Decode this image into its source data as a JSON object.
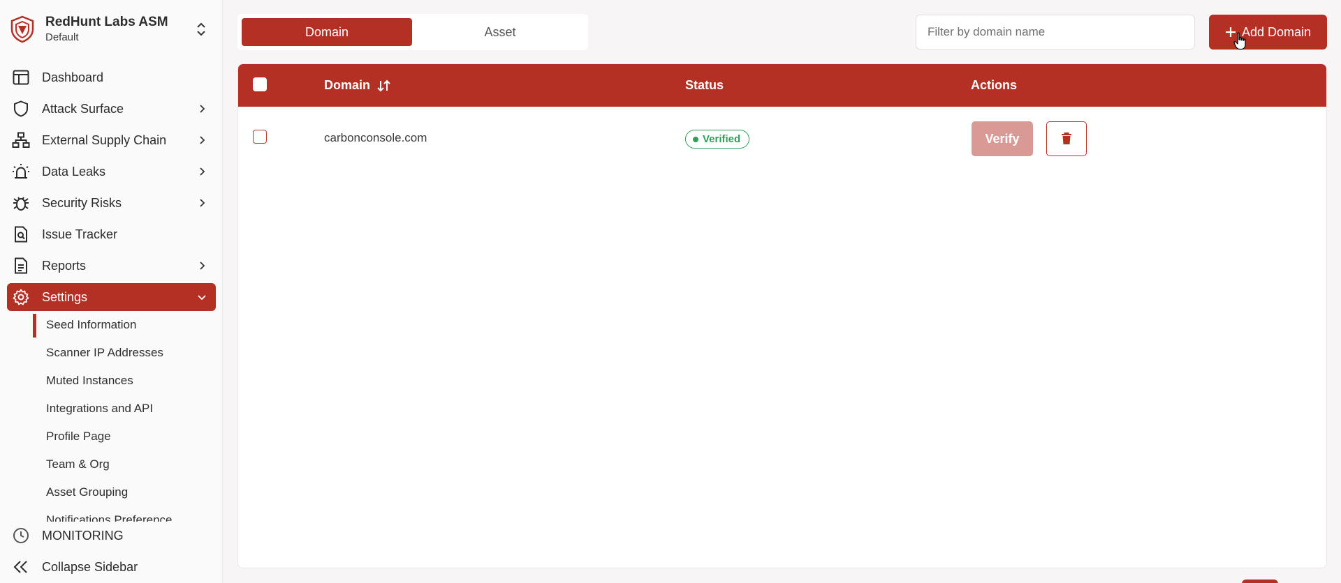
{
  "brand": {
    "name": "RedHunt Labs ASM",
    "workspace": "Default",
    "logo_icon": "shield-logo-icon",
    "switch_icon": "chevron-up-down-icon"
  },
  "sidebar": {
    "items": [
      {
        "label": "Dashboard",
        "icon": "layout-icon"
      },
      {
        "label": "Attack Surface",
        "icon": "shield-icon"
      },
      {
        "label": "External Supply Chain",
        "icon": "network-icon"
      },
      {
        "label": "Data Leaks",
        "icon": "alarm-icon"
      },
      {
        "label": "Security Risks",
        "icon": "bug-icon"
      },
      {
        "label": "Issue Tracker",
        "icon": "file-search-icon"
      },
      {
        "label": "Reports",
        "icon": "document-icon"
      },
      {
        "label": "Settings",
        "icon": "gear-icon"
      }
    ],
    "settings_sub": [
      "Seed Information",
      "Scanner IP Addresses",
      "Muted Instances",
      "Integrations and API",
      "Profile Page",
      "Team & Org",
      "Asset Grouping",
      "Notifications Preference"
    ],
    "monitoring": "MONITORING",
    "collapse": "Collapse Sidebar"
  },
  "tabs": {
    "domain": "Domain",
    "asset": "Asset"
  },
  "filter": {
    "placeholder": "Filter by domain name"
  },
  "add_button": "Add Domain",
  "table": {
    "headers": {
      "domain": "Domain",
      "status": "Status",
      "actions": "Actions"
    },
    "rows": [
      {
        "domain": "carbonconsole.com",
        "status": "Verified",
        "verify": "Verify"
      }
    ]
  },
  "colors": {
    "accent": "#b42f24",
    "verified": "#2e9e5c",
    "verify_disabled": "#d99a95"
  }
}
